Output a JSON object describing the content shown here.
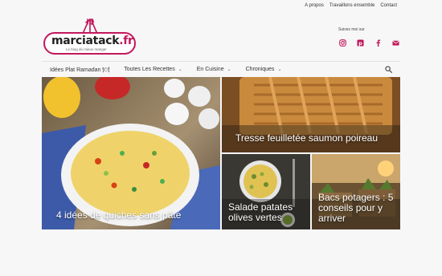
{
  "top_links": [
    "A propos",
    "Travaillons ensemble",
    "Contact"
  ],
  "logo": {
    "name": "marciatack",
    "tld": ".fr",
    "tagline": "Le blog du mieux manger"
  },
  "follow_label": "Suivez moi sur",
  "social_icons": [
    "instagram-icon",
    "pinterest-icon",
    "facebook-icon",
    "email-icon"
  ],
  "nav": [
    {
      "label": "Idées Plat Ramadan 🍽",
      "has_menu": false
    },
    {
      "label": "Toutes Les Recettes",
      "has_menu": true
    },
    {
      "label": "En Cuisine",
      "has_menu": true
    },
    {
      "label": "Chroniques",
      "has_menu": true
    }
  ],
  "posts": [
    {
      "title": "4 idées de quiches sans pâte"
    },
    {
      "title": "Tresse feuilletée saumon poireau"
    },
    {
      "title": "Salade patates olives vertes"
    },
    {
      "title": "Bacs potagers : 5 conseils pour y arriver"
    }
  ],
  "colors": {
    "accent": "#c2185b"
  }
}
